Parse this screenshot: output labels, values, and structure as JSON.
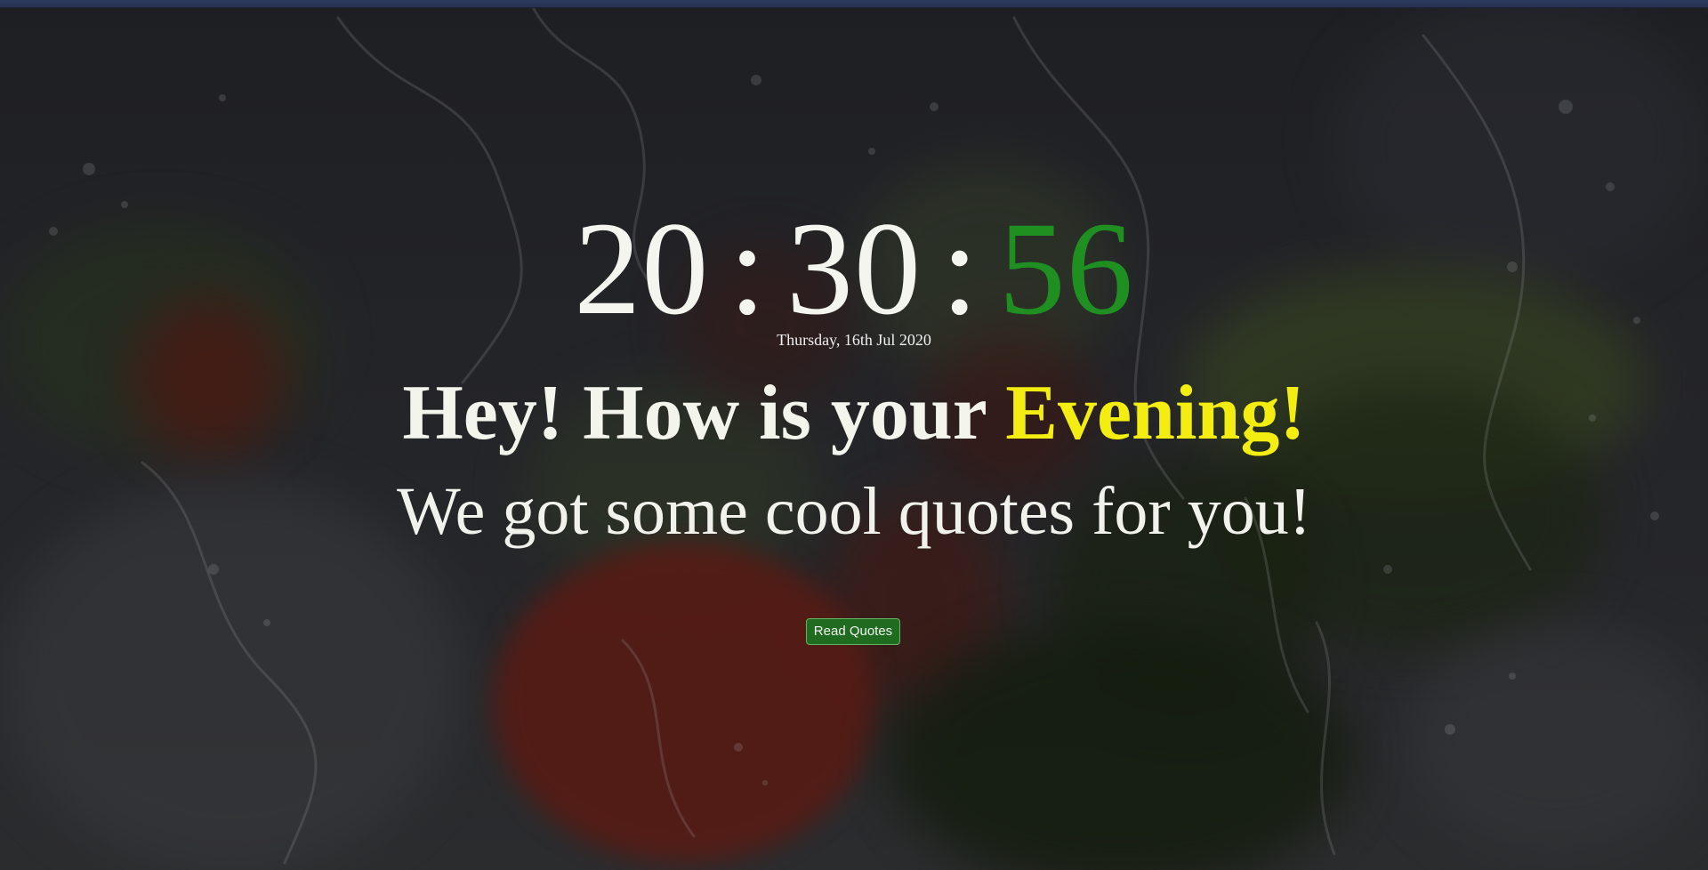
{
  "clock": {
    "hours": "20",
    "minutes": "30",
    "seconds": "56",
    "separator": ":"
  },
  "date": "Thursday, 16th Jul 2020",
  "greeting": {
    "prefix": "Hey! How is your ",
    "period": "Evening!"
  },
  "subtitle": "We got some cool quotes for you!",
  "read_quotes_button": {
    "label": "Read Quotes"
  },
  "colors": {
    "seconds": "#1f8f22",
    "period": "#f3ed12",
    "button_bg": "#1f6b1f",
    "text": "#f3f4ec"
  },
  "background": {
    "description_icon": "vegetables-water-splash-image"
  }
}
